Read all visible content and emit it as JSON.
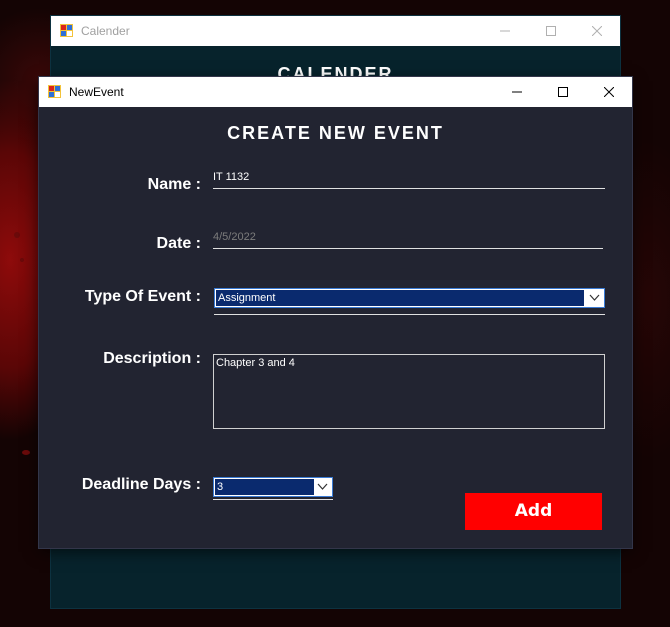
{
  "back_window": {
    "title": "Calender",
    "heading": "CALENDER"
  },
  "dialog": {
    "title": "NewEvent",
    "heading": "CREATE NEW EVENT",
    "fields": {
      "name": {
        "label": "Name :",
        "value": "IT 1132"
      },
      "date": {
        "label": "Date :",
        "value": "4/5/2022"
      },
      "type_of_event": {
        "label": "Type Of Event :",
        "value": "Assignment"
      },
      "description": {
        "label": "Description :",
        "value": "Chapter 3 and 4"
      },
      "deadline_days": {
        "label": "Deadline Days :",
        "value": "3"
      }
    },
    "add_button": "Add"
  },
  "colors": {
    "dialog_bg": "#222431",
    "back_bg": "#07232c",
    "accent_button": "#ff0000",
    "selection": "#0a2a6e"
  },
  "icons": {
    "app": "app-icon",
    "minimize": "minimize-icon",
    "maximize": "maximize-icon",
    "close": "close-icon",
    "dropdown": "chevron-down-icon"
  }
}
